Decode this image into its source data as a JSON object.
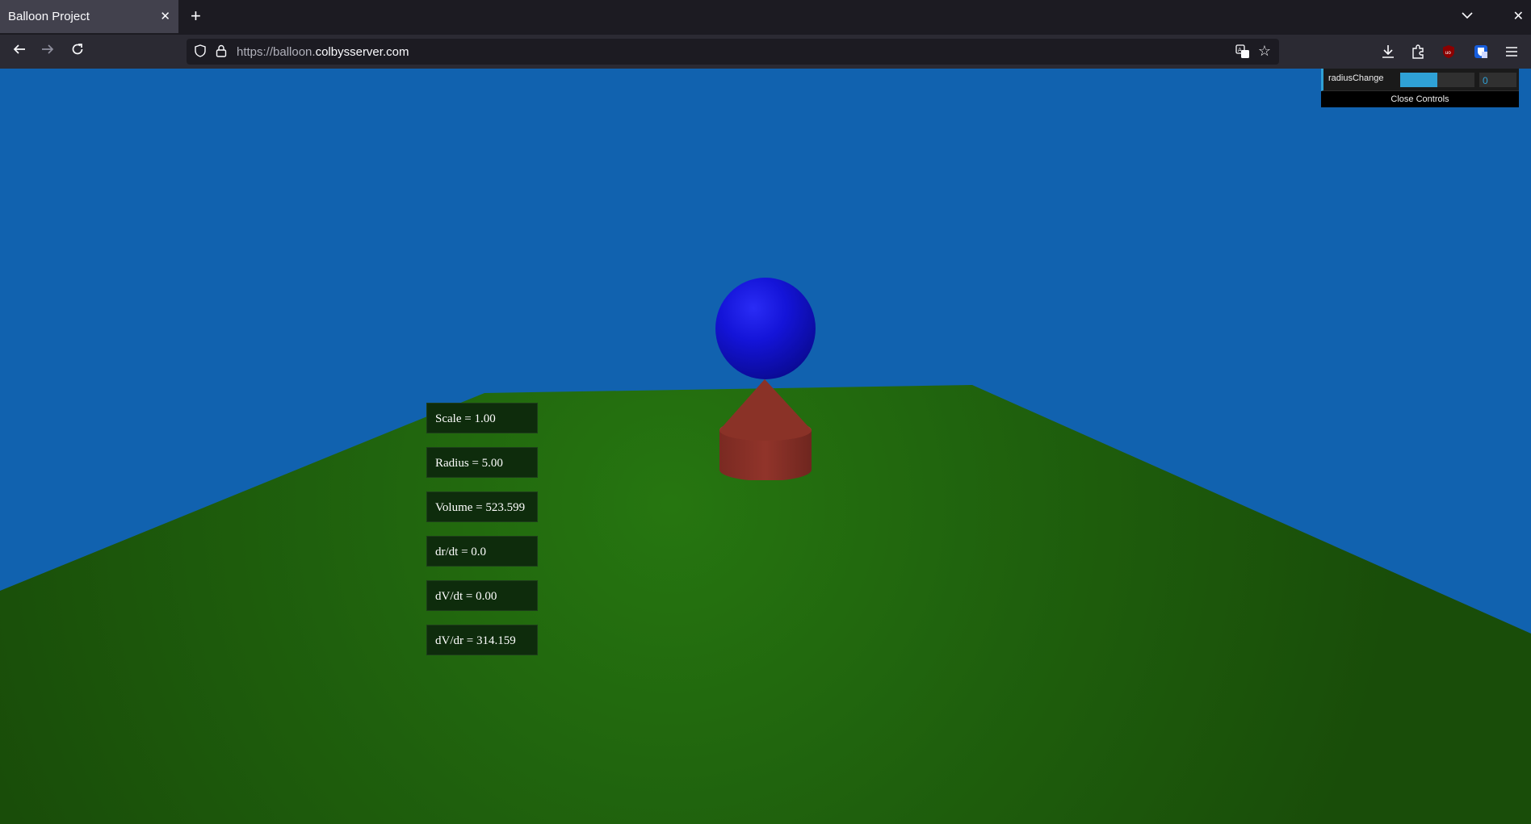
{
  "browser": {
    "tab_title": "Balloon Project",
    "tab_close": "✕",
    "new_tab": "+",
    "url_scheme": "https://balloon.",
    "url_domain": "colbysserver.com"
  },
  "stats": [
    {
      "text": "Scale = 1.00"
    },
    {
      "text": "Radius = 5.00"
    },
    {
      "text": "Volume = 523.599"
    },
    {
      "text": "dr/dt = 0.0"
    },
    {
      "text": "dV/dt = 0.00"
    },
    {
      "text": "dV/dr = 314.159"
    }
  ],
  "gui": {
    "control_label": "radiusChange",
    "control_value": "0",
    "slider_fraction": 0.5,
    "close_label": "Close Controls"
  },
  "colors": {
    "sky": "#1162af",
    "ground": "#236a10",
    "balloon": "#1414d8",
    "base": "#8a2f27",
    "accent": "#2fa1d6"
  }
}
